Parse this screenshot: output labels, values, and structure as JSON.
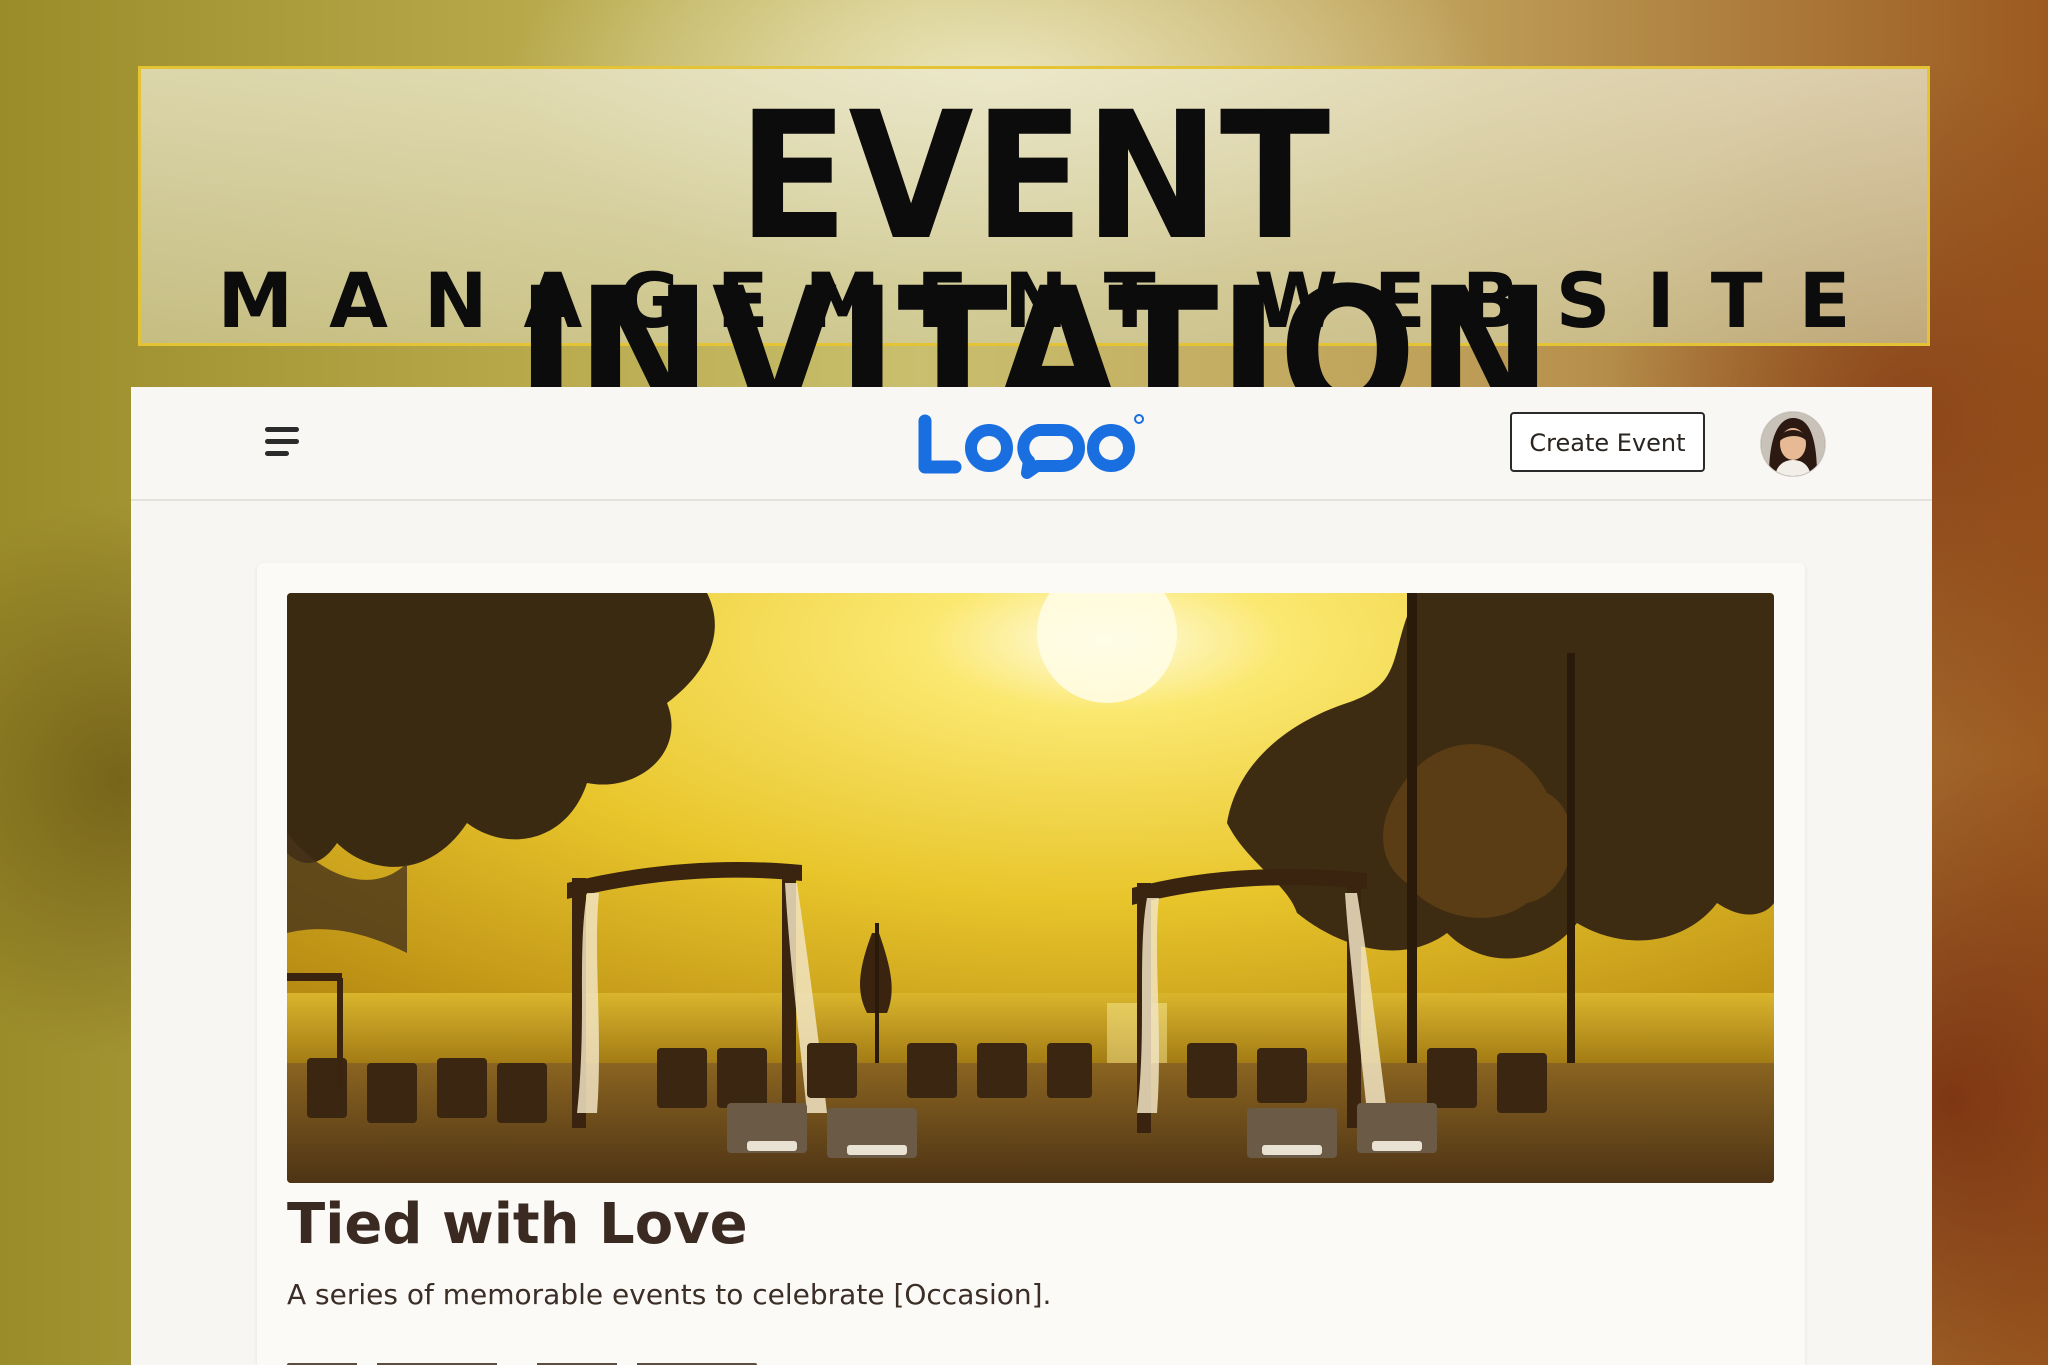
{
  "banner": {
    "title": "EVENT INVITATION",
    "subtitle": "MANAGEMENT WEBSITE"
  },
  "header": {
    "logo_text": "LOGO",
    "create_event_label": "Create Event"
  },
  "event": {
    "title": "Tied with Love",
    "description": "A series of memorable events to celebrate [Occasion]."
  },
  "icons": {
    "menu": "menu-icon",
    "avatar": "user-avatar"
  },
  "colors": {
    "logo_blue": "#1a6fe0",
    "banner_border": "#e4c434",
    "title_text": "#3b2a22"
  }
}
